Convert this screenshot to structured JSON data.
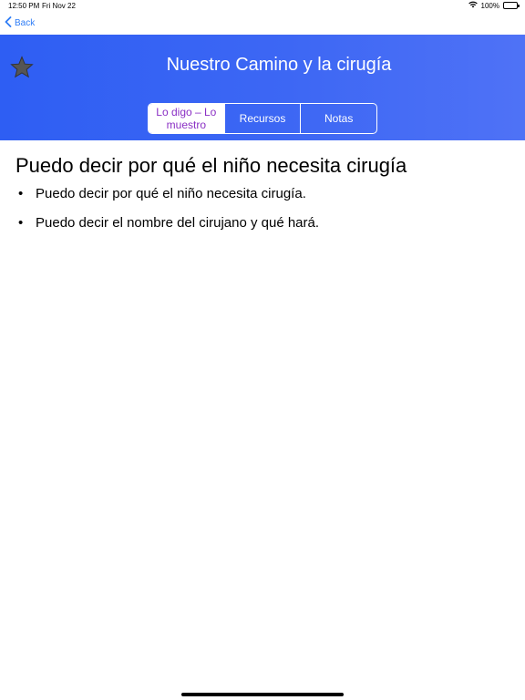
{
  "status_bar": {
    "time": "12:50 PM",
    "date": "Fri Nov 22",
    "battery": "100%"
  },
  "nav": {
    "back_label": "Back"
  },
  "header": {
    "title": "Nuestro Camino y la cirugía",
    "gradient_start": "#2e5ef3",
    "gradient_end": "#4f72f6",
    "tabs": [
      {
        "label": "Lo digo – Lo muestro",
        "selected": true
      },
      {
        "label": "Recursos",
        "selected": false
      },
      {
        "label": "Notas",
        "selected": false
      }
    ],
    "active_tab_text_color": "#8a2fc4"
  },
  "content": {
    "heading": "Puedo decir por qué el niño necesita cirugía",
    "bullet_marker": "•",
    "items": [
      "Puedo decir por qué el niño necesita cirugía.",
      "Puedo decir el nombre del cirujano y qué hará."
    ]
  },
  "icons": {
    "star": "star-icon",
    "back": "chevron-left-icon",
    "wifi": "wifi-icon",
    "battery": "battery-icon"
  }
}
